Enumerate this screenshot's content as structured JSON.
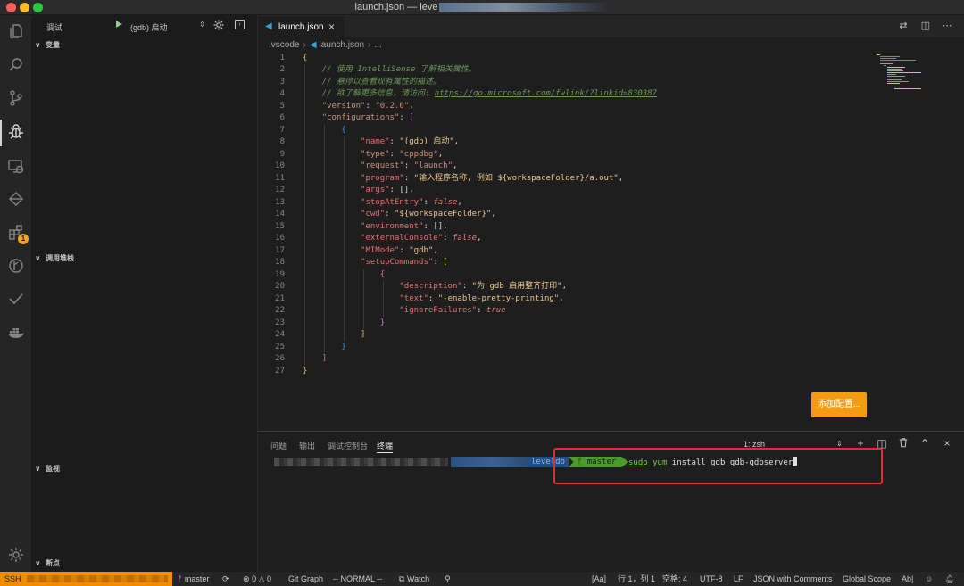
{
  "window": {
    "title_prefix": "launch.json — leve"
  },
  "activity_bar": {
    "icons": [
      "files-icon",
      "search-icon",
      "source-control-icon",
      "debug-icon",
      "remote-explorer-icon",
      "git-graph-icon",
      "extensions-icon",
      "gitlens-icon",
      "checkmark-icon",
      "docker-icon",
      "settings-gear-icon"
    ],
    "extensions_badge": "1"
  },
  "sidebar": {
    "debug_title": "调试",
    "config_name": "(gdb) 启动",
    "sections": {
      "variables": "变量",
      "call_stack": "调用堆栈",
      "watch": "监视",
      "breakpoints": "断点"
    }
  },
  "editor": {
    "tab_label": "launch.json",
    "breadcrumbs": [
      ".vscode",
      "launch.json",
      "..."
    ],
    "line_numbers": [
      "1",
      "2",
      "3",
      "4",
      "5",
      "6",
      "7",
      "8",
      "9",
      "10",
      "11",
      "12",
      "13",
      "14",
      "15",
      "16",
      "17",
      "18",
      "19",
      "20",
      "21",
      "22",
      "23",
      "24",
      "25",
      "26",
      "27"
    ],
    "comments": {
      "l2": "// 使用 IntelliSense 了解相关属性。",
      "l3": "// 悬停以查看现有属性的描述。",
      "l4_prefix": "// 欲了解更多信息，请访问: ",
      "l4_link": "https://go.microsoft.com/fwlink/?linkid=830387"
    },
    "version_key": "\"version\"",
    "version_value": "\"0.2.0\"",
    "configurations_key": "\"configurations\"",
    "props": {
      "name_key": "\"name\"",
      "name_val": "\"(gdb) 启动\"",
      "type_key": "\"type\"",
      "type_val": "\"cppdbg\"",
      "request_key": "\"request\"",
      "request_val": "\"launch\"",
      "program_key": "\"program\"",
      "program_val": "\"输入程序名称, 例如 ${workspaceFolder}/a.out\"",
      "args_key": "\"args\"",
      "args_val": "[]",
      "stop_key": "\"stopAtEntry\"",
      "stop_val": "false",
      "cwd_key": "\"cwd\"",
      "cwd_val": "\"${workspaceFolder}\"",
      "env_key": "\"environment\"",
      "env_val": "[]",
      "ext_key": "\"externalConsole\"",
      "ext_val": "false",
      "mimode_key": "\"MIMode\"",
      "mimode_val": "\"gdb\"",
      "setup_key": "\"setupCommands\"",
      "desc_key": "\"description\"",
      "desc_val": "\"为 gdb 启用整齐打印\"",
      "text_key": "\"text\"",
      "text_val": "\"-enable-pretty-printing\"",
      "ignore_key": "\"ignoreFailures\"",
      "ignore_val": "true"
    },
    "add_config_button": "添加配置..."
  },
  "panel": {
    "tabs": [
      "问题",
      "输出",
      "调试控制台",
      "终端"
    ],
    "active_tab": "终端",
    "terminal_select": "1: zsh",
    "prompt_dir": "leveldb",
    "prompt_branch": "master",
    "command_sudo": "sudo",
    "command_yum": "yum",
    "command_rest": " install gdb gdb-gdbserver"
  },
  "status_bar": {
    "ssh_label": "SSH",
    "branch": "master",
    "errors": "0",
    "warnings": "0",
    "git_graph": "Git Graph",
    "vim_mode": "-- NORMAL --",
    "watch": "Watch",
    "aa": "[Aa]",
    "cursor_pos": "行 1，列 1",
    "spaces": "空格: 4",
    "encoding": "UTF-8",
    "eol": "LF",
    "language": "JSON with Comments",
    "scope": "Global Scope",
    "ab": "Ab|"
  },
  "colors": {
    "accent_orange": "#f08c00",
    "add_config_bg": "#f39c12",
    "annotation_red": "#e52b2b",
    "git_segment_green": "#4c9a2a"
  }
}
